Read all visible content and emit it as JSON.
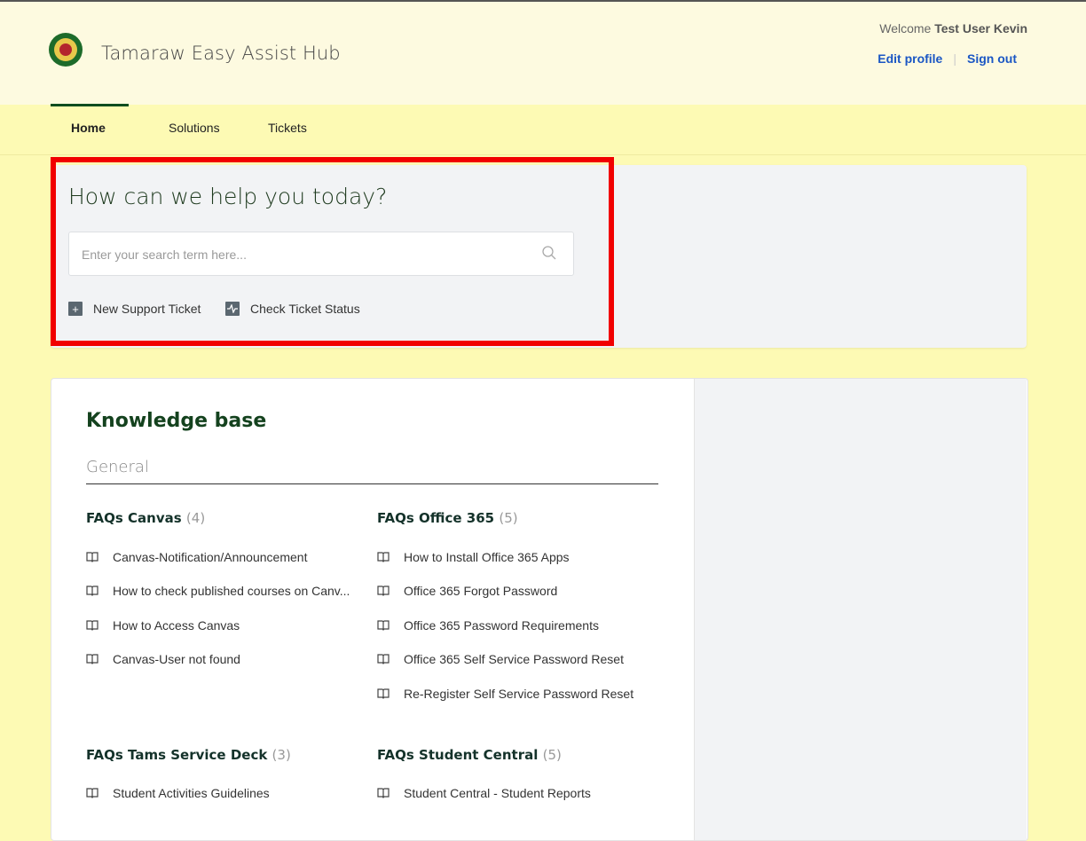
{
  "header": {
    "site_title": "Tamaraw Easy Assist Hub",
    "welcome_prefix": "Welcome",
    "user_name": "Test User Kevin",
    "edit_profile": "Edit profile",
    "sign_out": "Sign out"
  },
  "nav": {
    "tabs": [
      {
        "label": "Home",
        "active": true
      },
      {
        "label": "Solutions",
        "active": false
      },
      {
        "label": "Tickets",
        "active": false
      }
    ]
  },
  "hero": {
    "title": "How can we help you today?",
    "search_placeholder": "Enter your search term here...",
    "actions": [
      {
        "label": "New Support Ticket",
        "icon": "plus-icon"
      },
      {
        "label": "Check Ticket Status",
        "icon": "pulse-icon"
      }
    ]
  },
  "knowledge_base": {
    "title": "Knowledge base",
    "section": "General",
    "categories": [
      {
        "title": "FAQs Canvas",
        "count": "(4)",
        "articles": [
          "Canvas-Notification/Announcement",
          "How to check published courses on Canv...",
          "How to Access Canvas",
          "Canvas-User not found"
        ]
      },
      {
        "title": "FAQs Office 365",
        "count": "(5)",
        "articles": [
          "How to Install Office 365 Apps",
          "Office 365 Forgot Password",
          "Office 365 Password Requirements",
          "Office 365 Self Service Password Reset",
          "Re-Register Self Service Password Reset"
        ]
      },
      {
        "title": "FAQs Tams Service Deck",
        "count": "(3)",
        "articles": [
          "Student Activities Guidelines"
        ]
      },
      {
        "title": "FAQs Student Central",
        "count": "(5)",
        "articles": [
          "Student Central - Student Reports"
        ]
      }
    ]
  },
  "colors": {
    "page_background": "#fdfab4",
    "header_background": "#fdfae0",
    "accent_green": "#14421e",
    "link_blue": "#1a56c4",
    "highlight_red": "#f10000"
  }
}
